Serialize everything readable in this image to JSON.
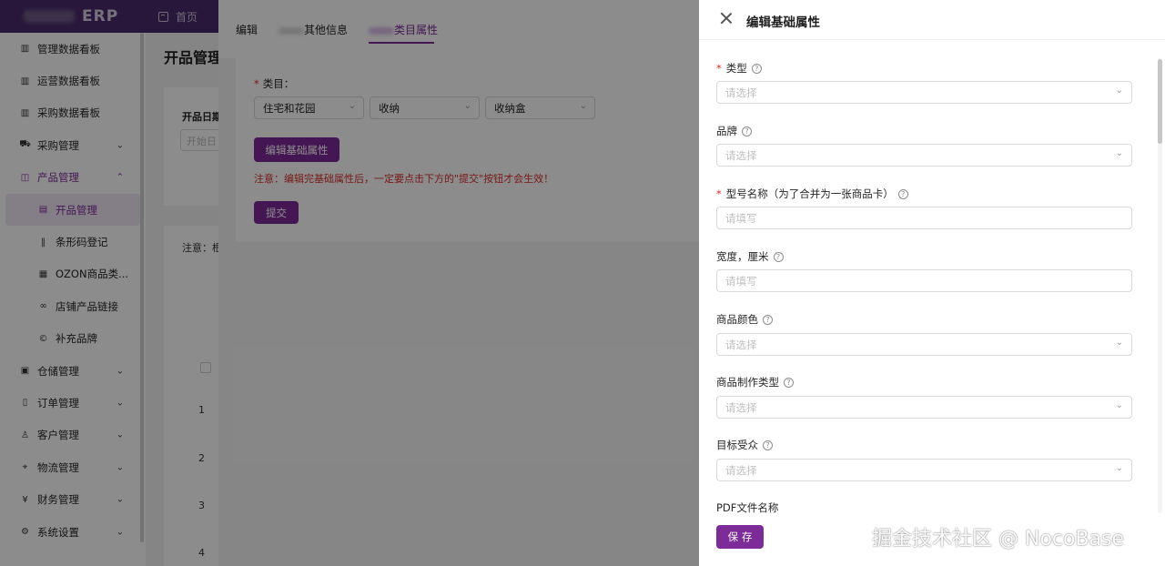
{
  "topbar": {
    "logo_text": "ERP",
    "home_label": "首页"
  },
  "sidebar": {
    "items": [
      {
        "label": "管理数据看板",
        "icon": "chart-icon"
      },
      {
        "label": "运营数据看板",
        "icon": "chart-icon"
      },
      {
        "label": "采购数据看板",
        "icon": "chart-icon"
      },
      {
        "label": "采购管理",
        "icon": "cart-icon"
      },
      {
        "label": "产品管理",
        "icon": "box-icon"
      },
      {
        "label": "开品管理",
        "icon": "file-icon"
      },
      {
        "label": "条形码登记",
        "icon": "barcode-icon"
      },
      {
        "label": "OZON商品类...",
        "icon": "grid-icon"
      },
      {
        "label": "店铺产品链接",
        "icon": "link-icon"
      },
      {
        "label": "补充品牌",
        "icon": "copyright-icon"
      },
      {
        "label": "仓储管理",
        "icon": "warehouse-icon"
      },
      {
        "label": "订单管理",
        "icon": "order-icon"
      },
      {
        "label": "客户管理",
        "icon": "user-icon"
      },
      {
        "label": "物流管理",
        "icon": "location-icon"
      },
      {
        "label": "财务管理",
        "icon": "money-icon"
      },
      {
        "label": "系统设置",
        "icon": "settings-icon"
      }
    ]
  },
  "main": {
    "title": "开品管理",
    "filter_label": "开品日期",
    "filter_placeholder": "开始日",
    "note": "注意：根",
    "row_numbers": [
      "1",
      "2",
      "3",
      "4"
    ]
  },
  "modal": {
    "tabs": [
      "编辑",
      "其他信息",
      "类目属性"
    ],
    "category_label": "类目：",
    "category_values": [
      "住宅和花园",
      "收纳",
      "收纳盒"
    ],
    "edit_button": "编辑基础属性",
    "warning": "注意：编辑完基础属性后，一定要点击下方的\"提交\"按钮才会生效！",
    "submit_button": "提交"
  },
  "drawer": {
    "title": "编辑基础属性",
    "fields": [
      {
        "label": "类型",
        "required": true,
        "help": true,
        "placeholder": "请选择",
        "kind": "select"
      },
      {
        "label": "品牌",
        "required": false,
        "help": true,
        "placeholder": "请选择",
        "kind": "select"
      },
      {
        "label": "型号名称（为了合并为一张商品卡）",
        "required": true,
        "help": true,
        "placeholder": "请填写",
        "kind": "input"
      },
      {
        "label": "宽度，厘米",
        "required": false,
        "help": true,
        "placeholder": "请填写",
        "kind": "input"
      },
      {
        "label": "商品颜色",
        "required": false,
        "help": true,
        "placeholder": "请选择",
        "kind": "select"
      },
      {
        "label": "商品制作类型",
        "required": false,
        "help": true,
        "placeholder": "请选择",
        "kind": "select"
      },
      {
        "label": "目标受众",
        "required": false,
        "help": true,
        "placeholder": "请选择",
        "kind": "select"
      },
      {
        "label": "PDF文件名称",
        "required": false,
        "help": false
      }
    ],
    "save_button": "保 存"
  },
  "watermark": "掘金技术社区 @ NocoBase",
  "colors": {
    "brand": "#7d2b99",
    "topbar": "#4a2a6a",
    "warning": "#d9302d",
    "required": "#e0282e"
  }
}
